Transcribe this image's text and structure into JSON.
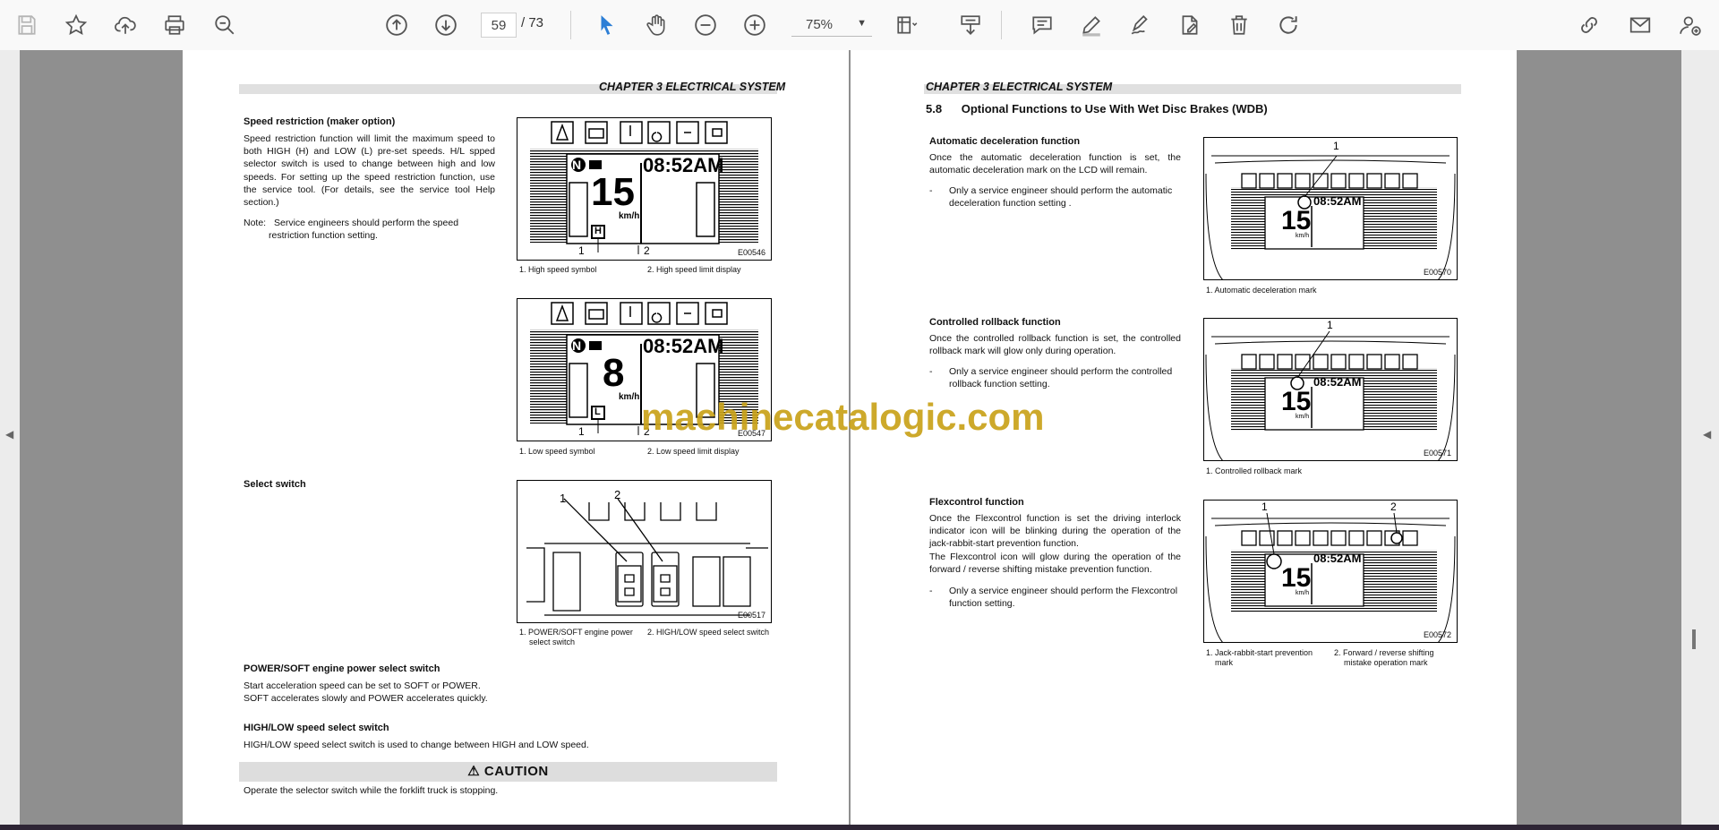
{
  "toolbar": {
    "page_current": "59",
    "page_total": "/ 73",
    "zoom": "75%",
    "icons": [
      "save-icon",
      "bookmark-star-icon",
      "upload-cloud-icon",
      "print-icon",
      "zoom-search-icon",
      "page-up-icon",
      "page-down-icon",
      "select-arrow-icon",
      "hand-icon",
      "zoom-out-icon",
      "zoom-in-icon",
      "fit-page-icon",
      "download-page-icon",
      "comment-icon",
      "pen-icon",
      "sign-icon",
      "edit-doc-icon",
      "delete-icon",
      "redo-icon",
      "link-icon",
      "mail-icon",
      "add-user-icon"
    ]
  },
  "watermark": "machinecatalogic.com",
  "left_page": {
    "header": "CHAPTER 3 ELECTRICAL SYSTEM",
    "speed": {
      "title": "Speed restriction (maker option)",
      "body": "Speed restriction function will limit the maximum speed to both HIGH (H) and LOW (L) pre-set speeds. H/L spped selector switch is used to change between high and low speeds. For setting up the speed restriction function, use the service tool. (For details, see the service tool Help section.)",
      "note_label": "Note:",
      "note_line1": "Service engineers should perform the speed",
      "note_line2": "restriction function setting."
    },
    "fig1": {
      "code": "E00546",
      "time": "08:52AM",
      "speed": "15",
      "unit": "km/h",
      "mode": "H",
      "n": "N",
      "c1": "1",
      "c2": "2",
      "cap1": "1.  High speed symbol",
      "cap2": "2.  High speed limit display"
    },
    "fig2": {
      "code": "E00547",
      "time": "08:52AM",
      "speed": "8",
      "unit": "km/h",
      "mode": "L",
      "n": "N",
      "c1": "1",
      "c2": "2",
      "cap1": "1.  Low speed symbol",
      "cap2": "2.  Low speed limit display"
    },
    "select": {
      "title": "Select switch"
    },
    "fig3": {
      "code": "E00517",
      "c1": "1",
      "c2": "2",
      "cap1a": "1.  POWER/SOFT engine power",
      "cap1b": "select switch",
      "cap2": "2.  HIGH/LOW speed select switch"
    },
    "power": {
      "title": "POWER/SOFT engine power select switch",
      "line1": "Start acceleration speed can be set to SOFT or POWER.",
      "line2": "SOFT accelerates slowly and POWER accelerates quickly."
    },
    "hilow": {
      "title": "HIGH/LOW speed select switch",
      "line1": "HIGH/LOW speed select switch is used to change between HIGH and LOW speed."
    },
    "caution": {
      "label": "⚠ CAUTION",
      "text": "Operate the selector switch while the forklift truck is stopping."
    }
  },
  "right_page": {
    "header": "CHAPTER 3 ELECTRICAL SYSTEM",
    "section": "5.8      Optional Functions to Use With Wet Disc Brakes (WDB)",
    "auto": {
      "title": "Automatic deceleration function",
      "body": "Once the automatic deceleration function is set, the automatic deceleration mark on the LCD will remain.",
      "dash": "-",
      "b1": "Only a service engineer should perform the automatic",
      "b2": "deceleration function setting ."
    },
    "fig4": {
      "code": "E00570",
      "time": "08:52AM",
      "speed": "15",
      "unit": "km/h",
      "c1": "1",
      "cap1": "1.  Automatic deceleration mark"
    },
    "roll": {
      "title": "Controlled rollback function",
      "body": "Once the controlled rollback function is set, the controlled rollback mark will glow only during operation.",
      "dash": "-",
      "b1": "Only a service engineer should perform the controlled",
      "b2": "rollback function setting."
    },
    "fig5": {
      "code": "E00571",
      "time": "08:52AM",
      "speed": "15",
      "unit": "km/h",
      "c1": "1",
      "cap1": "1.  Controlled rollback mark"
    },
    "flex": {
      "title": "Flexcontrol function",
      "body1": "Once the Flexcontrol function is set the driving interlock indicator icon will be blinking during the operation of the jack-rabbit-start prevention function.",
      "body2": "The Flexcontrol icon will glow during the operation of the forward / reverse shifting mistake prevention function.",
      "dash": "-",
      "b1": "Only a service engineer should perform the Flexcontrol",
      "b2": "function setting."
    },
    "fig6": {
      "code": "E00572",
      "time": "08:52AM",
      "speed": "15",
      "unit": "km/h",
      "c1": "1",
      "c2": "2",
      "cap1a": "1.  Jack-rabbit-start prevention",
      "cap1b": "mark",
      "cap2a": "2.  Forward / reverse shifting",
      "cap2b": "mistake operation mark"
    }
  }
}
